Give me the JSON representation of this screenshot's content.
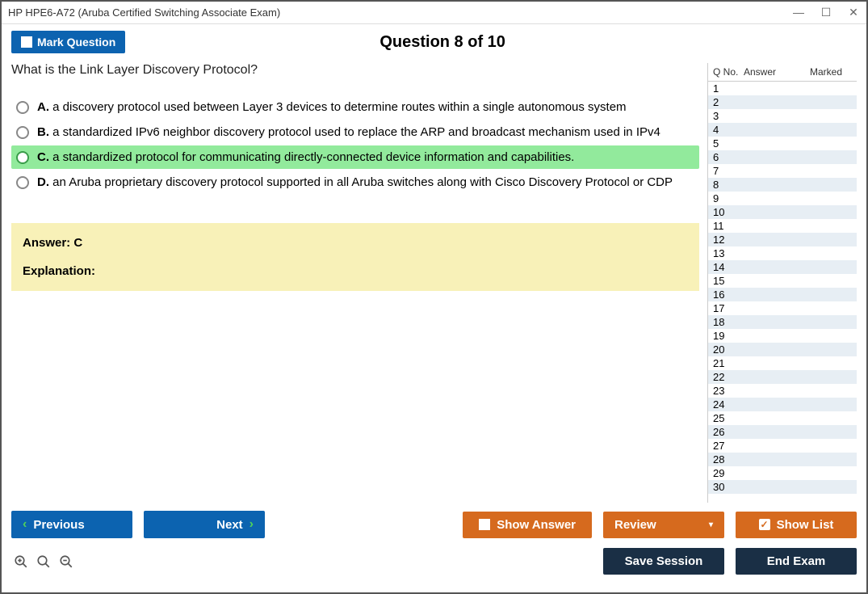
{
  "window": {
    "title": "HP HPE6-A72 (Aruba Certified Switching Associate Exam)"
  },
  "header": {
    "mark_label": "Mark Question",
    "question_title": "Question 8 of 10"
  },
  "question": {
    "text": "What is the Link Layer Discovery Protocol?",
    "choices": [
      {
        "letter": "A.",
        "text": "a discovery protocol used between Layer 3 devices to determine routes within a single autonomous system",
        "highlight": false
      },
      {
        "letter": "B.",
        "text": "a standardized IPv6 neighbor discovery protocol used to replace the ARP and broadcast mechanism used in IPv4",
        "highlight": false
      },
      {
        "letter": "C.",
        "text": "a standardized protocol for communicating directly-connected device information and capabilities.",
        "highlight": true
      },
      {
        "letter": "D.",
        "text": "an Aruba proprietary discovery protocol supported in all Aruba switches along with Cisco Discovery Protocol or CDP",
        "highlight": false
      }
    ],
    "answer_label": "Answer: C",
    "explanation_label": "Explanation:"
  },
  "sidebar": {
    "col_qno": "Q No.",
    "col_answer": "Answer",
    "col_marked": "Marked",
    "rows": [
      {
        "n": "1"
      },
      {
        "n": "2"
      },
      {
        "n": "3"
      },
      {
        "n": "4"
      },
      {
        "n": "5"
      },
      {
        "n": "6"
      },
      {
        "n": "7"
      },
      {
        "n": "8"
      },
      {
        "n": "9"
      },
      {
        "n": "10"
      },
      {
        "n": "11"
      },
      {
        "n": "12"
      },
      {
        "n": "13"
      },
      {
        "n": "14"
      },
      {
        "n": "15"
      },
      {
        "n": "16"
      },
      {
        "n": "17"
      },
      {
        "n": "18"
      },
      {
        "n": "19"
      },
      {
        "n": "20"
      },
      {
        "n": "21"
      },
      {
        "n": "22"
      },
      {
        "n": "23"
      },
      {
        "n": "24"
      },
      {
        "n": "25"
      },
      {
        "n": "26"
      },
      {
        "n": "27"
      },
      {
        "n": "28"
      },
      {
        "n": "29"
      },
      {
        "n": "30"
      }
    ]
  },
  "buttons": {
    "previous": "Previous",
    "next": "Next",
    "show_answer": "Show Answer",
    "review": "Review",
    "show_list": "Show List",
    "save_session": "Save Session",
    "end_exam": "End Exam"
  }
}
